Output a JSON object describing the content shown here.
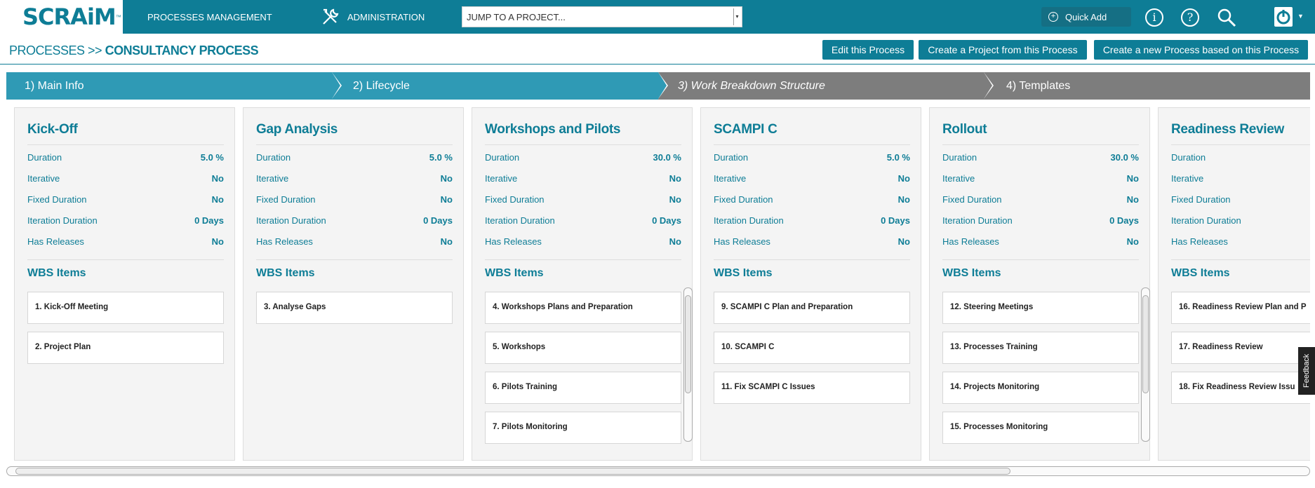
{
  "app": {
    "logo": "SCRAiM",
    "trademark": "™"
  },
  "nav": {
    "processes": "PROCESSES MANAGEMENT",
    "administration": "ADMINISTRATION",
    "jump_placeholder": "JUMP TO A PROJECT...",
    "quick_add": "Quick Add"
  },
  "header": {
    "crumb_prefix": "PROCESSES >>",
    "crumb_title": "CONSULTANCY PROCESS",
    "edit": "Edit this Process",
    "create_project": "Create a Project from this Process",
    "create_process": "Create a new Process based on this Process"
  },
  "steps": [
    "1) Main Info",
    "2) Lifecycle",
    "3) Work Breakdown Structure",
    "4) Templates"
  ],
  "labels": {
    "duration": "Duration",
    "iterative": "Iterative",
    "fixed": "Fixed Duration",
    "iter_duration": "Iteration Duration",
    "releases": "Has Releases",
    "wbs": "WBS Items"
  },
  "phases": [
    {
      "name": "Kick-Off",
      "duration": "5.0 %",
      "iterative": "No",
      "fixed": "No",
      "iter_duration": "0 Days",
      "releases": "No",
      "items": [
        "1. Kick-Off Meeting",
        "2. Project Plan"
      ]
    },
    {
      "name": "Gap Analysis",
      "duration": "5.0 %",
      "iterative": "No",
      "fixed": "No",
      "iter_duration": "0 Days",
      "releases": "No",
      "items": [
        "3. Analyse Gaps"
      ]
    },
    {
      "name": "Workshops and Pilots",
      "duration": "30.0 %",
      "iterative": "No",
      "fixed": "No",
      "iter_duration": "0 Days",
      "releases": "No",
      "items": [
        "4. Workshops Plans and Preparation",
        "5. Workshops",
        "6. Pilots Training",
        "7. Pilots Monitoring"
      ]
    },
    {
      "name": "SCAMPI C",
      "duration": "5.0 %",
      "iterative": "No",
      "fixed": "No",
      "iter_duration": "0 Days",
      "releases": "No",
      "items": [
        "9. SCAMPI C Plan and Preparation",
        "10. SCAMPI C",
        "11. Fix SCAMPI C Issues"
      ]
    },
    {
      "name": "Rollout",
      "duration": "30.0 %",
      "iterative": "No",
      "fixed": "No",
      "iter_duration": "0 Days",
      "releases": "No",
      "items": [
        "12. Steering Meetings",
        "13. Processes Training",
        "14. Projects Monitoring",
        "15. Processes Monitoring"
      ]
    },
    {
      "name": "Readiness Review",
      "duration": "",
      "iterative": "",
      "fixed": "",
      "iter_duration": "",
      "releases": "",
      "items": [
        "16. Readiness Review Plan and P",
        "17. Readiness Review",
        "18. Fix Readiness Review Issu"
      ]
    }
  ],
  "feedback": "Feedback"
}
